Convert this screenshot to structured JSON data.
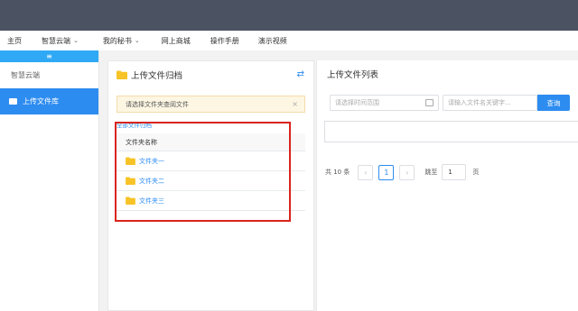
{
  "menubar": {
    "items": [
      {
        "label": "主页",
        "has_dropdown": false
      },
      {
        "label": "智慧云端",
        "has_dropdown": true
      },
      {
        "label": "我的秘书",
        "has_dropdown": true
      },
      {
        "label": "网上商城",
        "has_dropdown": false
      },
      {
        "label": "操作手册",
        "has_dropdown": false
      },
      {
        "label": "演示视频",
        "has_dropdown": false
      }
    ]
  },
  "sidebar": {
    "collapse_glyph": "≡",
    "group_label": "智慧云端",
    "active_item": {
      "label": "上传文件库",
      "icon": "folder-icon"
    }
  },
  "left_panel": {
    "title": "上传文件归档",
    "swap_icon": "⇄",
    "alert_text": "请选择文件夹查阅文件",
    "alert_close": "×",
    "breadcrumb_all": "全部文件归档",
    "table_header": "文件夹名称",
    "folders": [
      {
        "name": "文件夹一"
      },
      {
        "name": "文件夹二"
      },
      {
        "name": "文件夹三"
      }
    ]
  },
  "right_panel": {
    "title": "上传文件列表",
    "date_placeholder": "请选择时间范围",
    "keyword_placeholder": "请输入文件名关键字...",
    "query_label": "查询",
    "total_text": "共 10 条",
    "current_page": "1",
    "prev_glyph": "‹",
    "next_glyph": "›",
    "jump_label": "跳至",
    "jump_value": "1",
    "page_unit": "页"
  },
  "colors": {
    "topbar": "#4b5262",
    "accent": "#2d8cf0",
    "sidebar_collapse": "#2fa9f5",
    "folder": "#f7c326",
    "highlight": "#d9241c",
    "alert_bg": "#fdf6e3"
  }
}
